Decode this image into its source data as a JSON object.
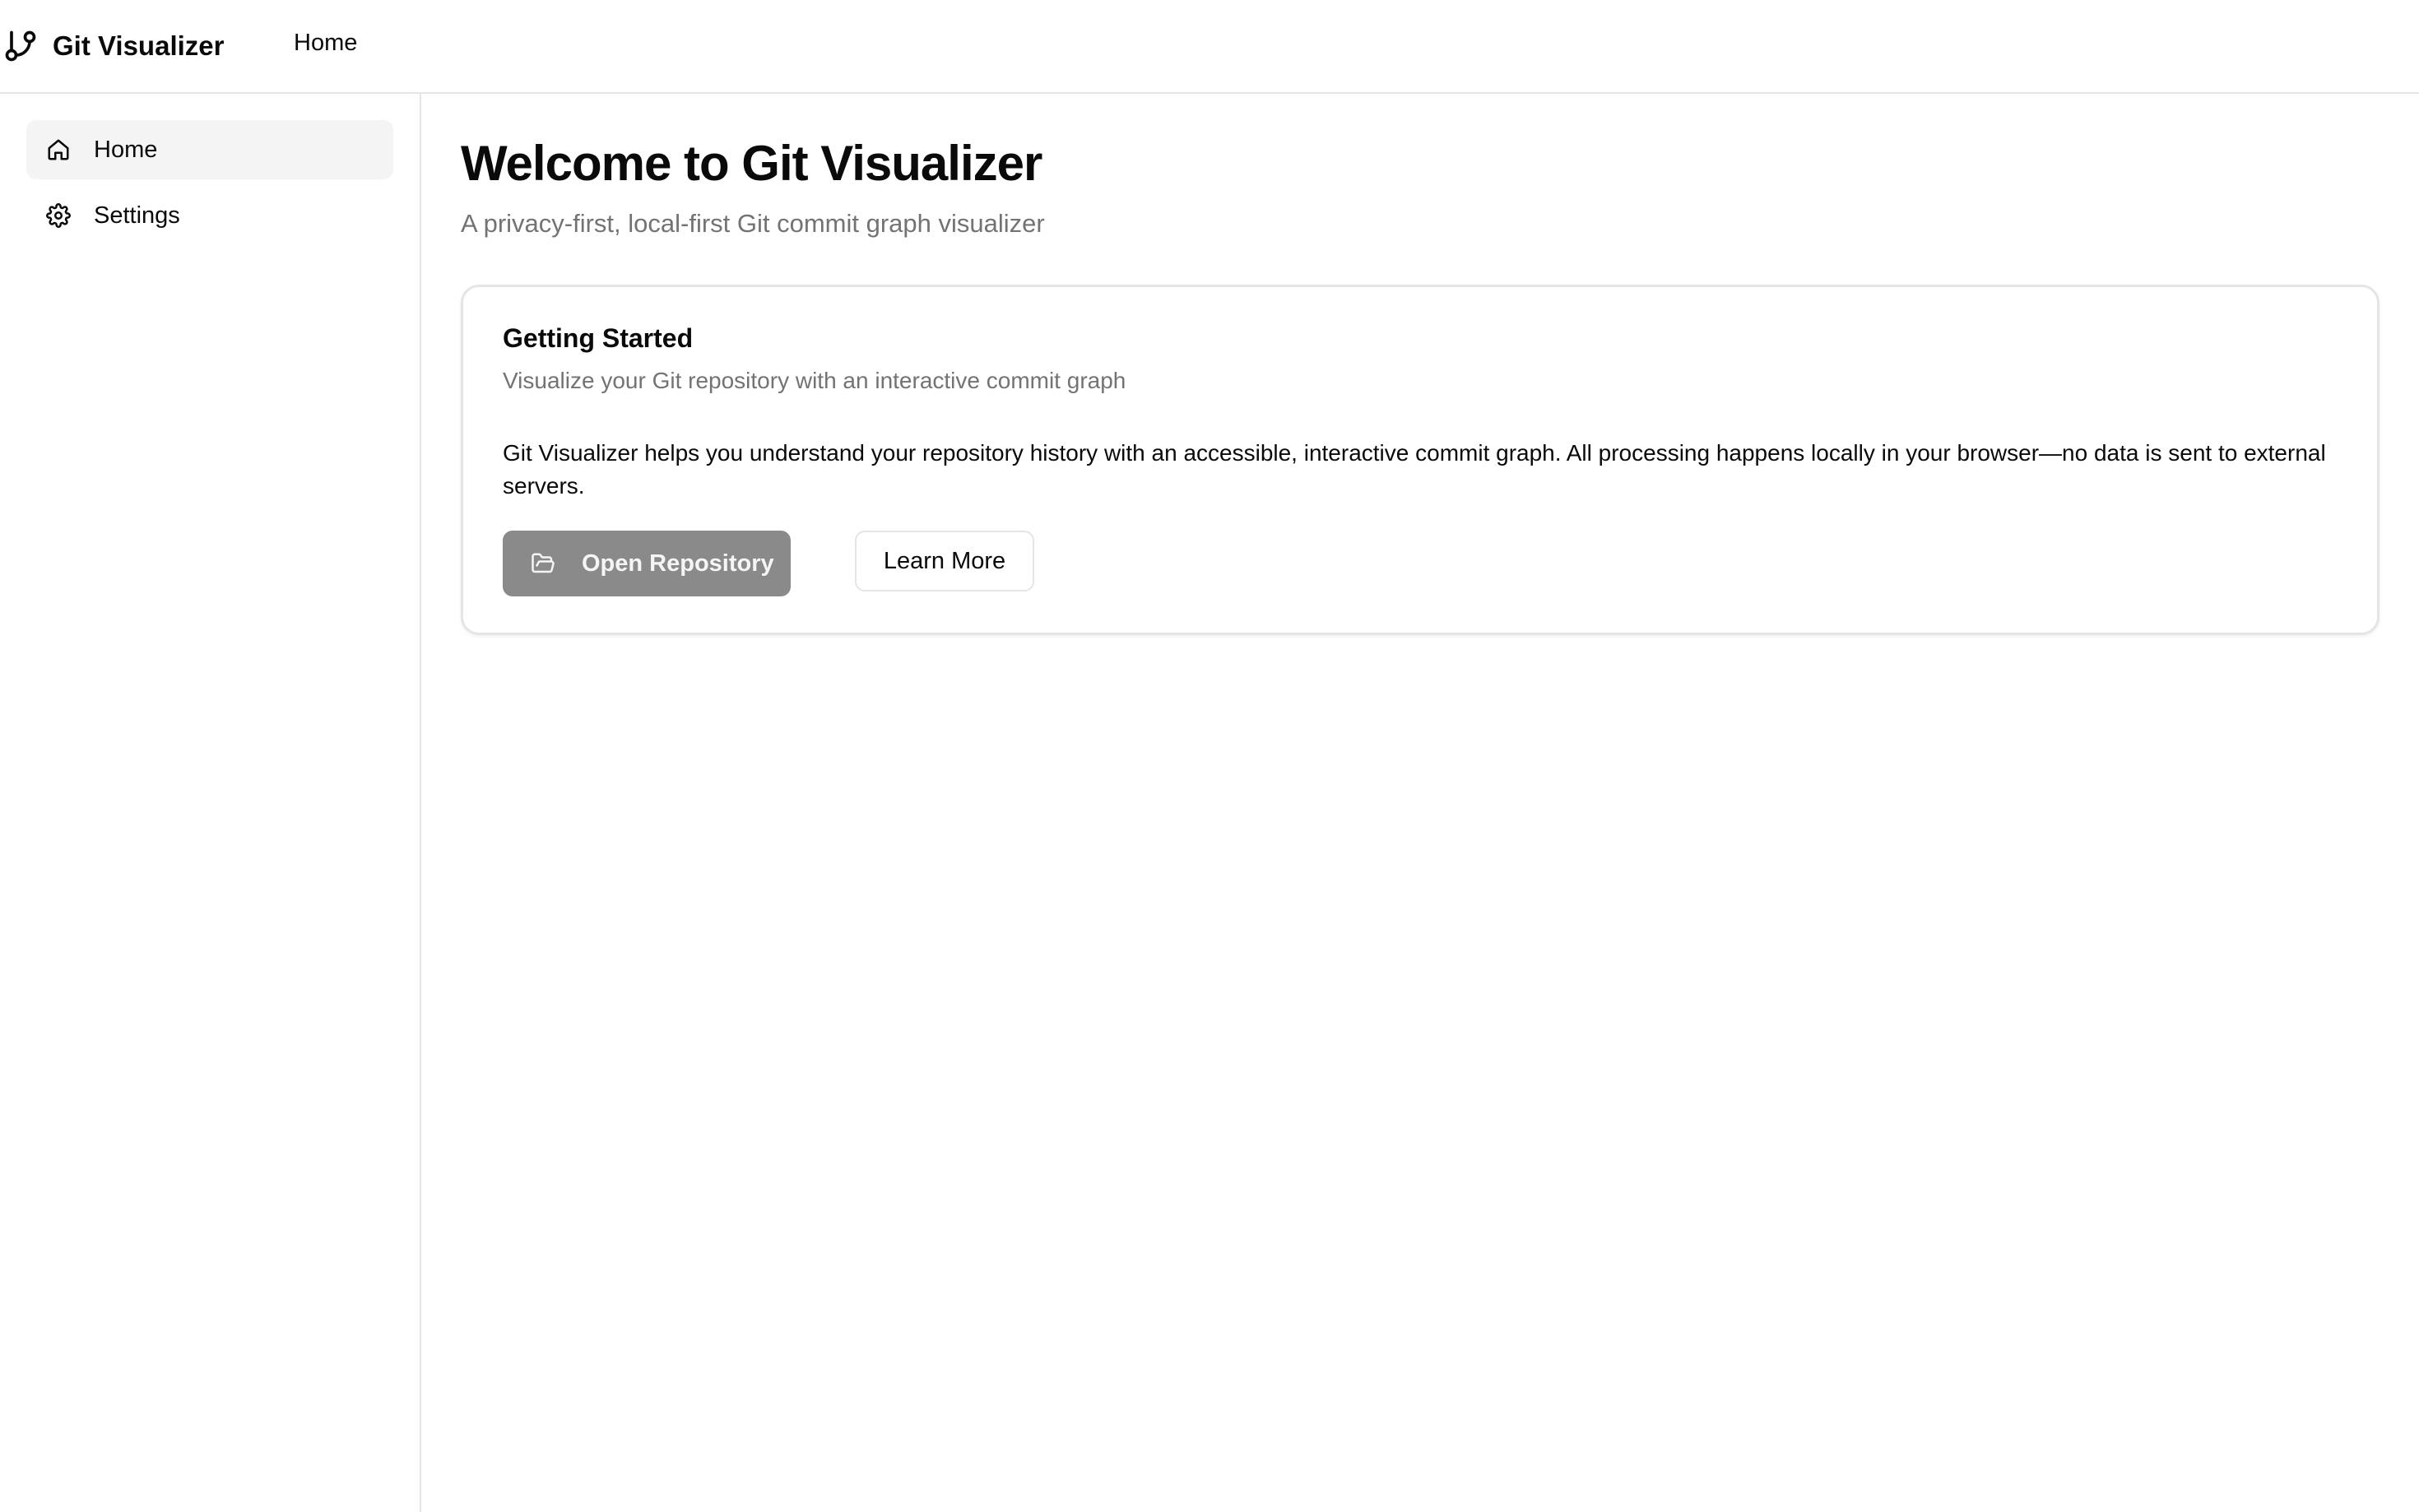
{
  "header": {
    "app_title": "Git Visualizer",
    "brand_icon": "git-branch-icon",
    "nav_home": "Home"
  },
  "sidebar": {
    "items": [
      {
        "label": "Home",
        "icon": "home-icon",
        "active": true
      },
      {
        "label": "Settings",
        "icon": "gear-icon",
        "active": false
      }
    ]
  },
  "main": {
    "title": "Welcome to Git Visualizer",
    "subtitle": "A privacy-first, local-first Git commit graph visualizer",
    "card": {
      "title": "Getting Started",
      "description": "Visualize your Git repository with an interactive commit graph",
      "body": "Git Visualizer helps you understand your repository history with an accessible, interactive commit graph. All processing happens locally in your browser—no data is sent to external servers.",
      "primary_button": {
        "label": "Open Repository",
        "icon": "folder-open-icon",
        "state": "disabled"
      },
      "secondary_button": {
        "label": "Learn More"
      }
    }
  },
  "colors": {
    "text": "#0a0a0a",
    "muted_text": "#737373",
    "border": "#e5e5e5",
    "active_item_bg": "#f4f4f4",
    "primary_button_bg": "#8a8a8a"
  }
}
